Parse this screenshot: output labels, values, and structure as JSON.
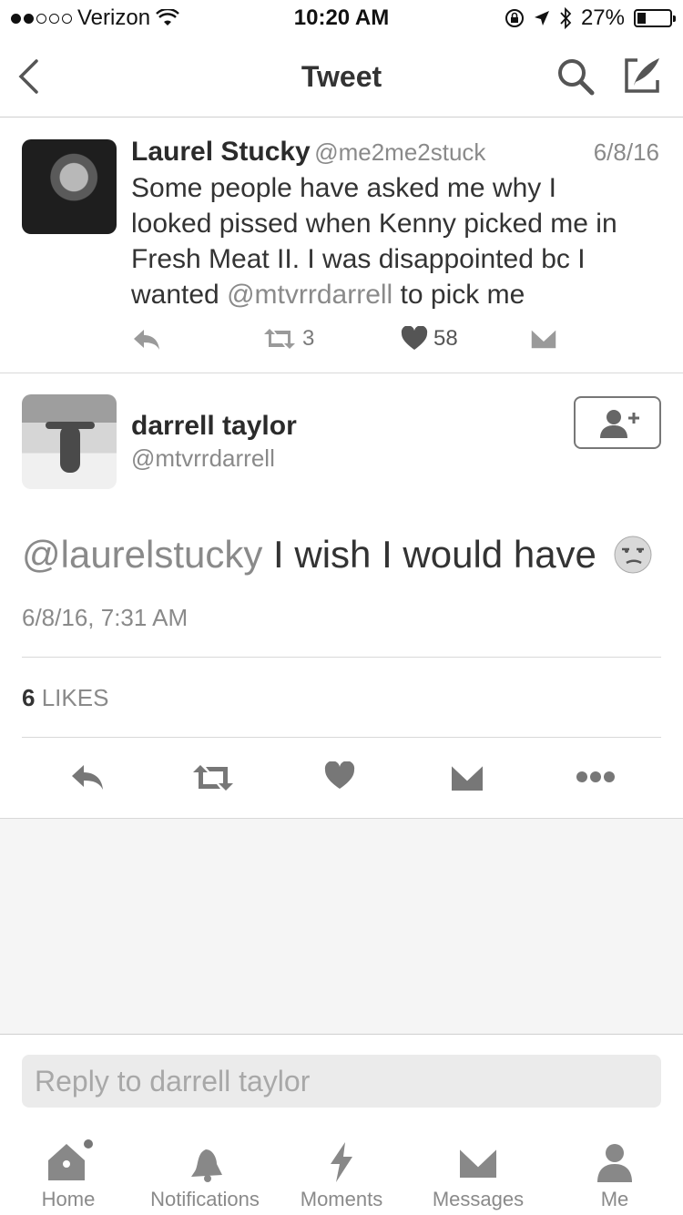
{
  "status_bar": {
    "carrier": "Verizon",
    "time": "10:20 AM",
    "battery": "27%"
  },
  "nav": {
    "title": "Tweet"
  },
  "parent_tweet": {
    "name": "Laurel Stucky",
    "handle": "@me2me2stuck",
    "date": "6/8/16",
    "text_lines": [
      "Some people have asked me why I",
      "looked pissed when Kenny picked me in",
      "Fresh Meat II. I was disappointed bc I"
    ],
    "last_line_prefix": "wanted ",
    "last_line_mention": "@mtvrrdarrell",
    "last_line_suffix": " to pick me",
    "retweets": "3",
    "likes": "58"
  },
  "main_tweet": {
    "name": "darrell taylor",
    "handle": "@mtvrrdarrell",
    "mention": "@laurelstucky",
    "text": " I wish I would have",
    "timestamp": "6/8/16, 7:31 AM",
    "likes_count": "6",
    "likes_label": "LIKES"
  },
  "reply": {
    "placeholder": "Reply to darrell taylor"
  },
  "tabs": [
    {
      "label": "Home",
      "icon": "home-icon"
    },
    {
      "label": "Notifications",
      "icon": "bell-icon"
    },
    {
      "label": "Moments",
      "icon": "lightning-icon"
    },
    {
      "label": "Messages",
      "icon": "envelope-icon"
    },
    {
      "label": "Me",
      "icon": "person-icon"
    }
  ]
}
